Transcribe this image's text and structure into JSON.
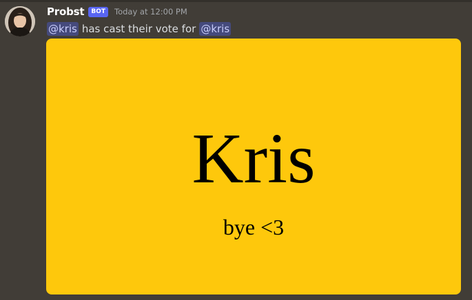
{
  "message": {
    "author": {
      "name": "Probst",
      "badge": "BOT",
      "avatar_icon": "person-photo-avatar"
    },
    "timestamp": "Today at 12:00 PM",
    "content": {
      "mention_1": "@kris",
      "text": "has cast their vote for",
      "mention_2": "@kris"
    },
    "attachment": {
      "background_color": "#fec80c",
      "title": "Kris",
      "caption": "bye <3"
    }
  },
  "colors": {
    "background": "#413d37",
    "mention_background": "#454a7c",
    "mention_text": "#c9cdfb",
    "bot_badge": "#5865f2"
  }
}
